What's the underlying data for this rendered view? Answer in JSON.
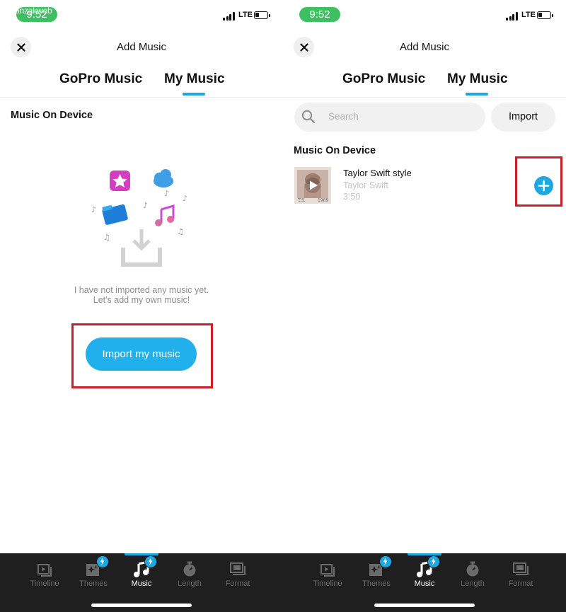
{
  "watermark": "anzakweb",
  "colors": {
    "accent": "#1fa8e0",
    "status_pill": "#3dbf62",
    "highlight_box": "#cc1f2a",
    "bottom_bar": "#1f1f1f"
  },
  "left_screen": {
    "status": {
      "time": "9:52",
      "network": "LTE"
    },
    "header": {
      "title": "Add Music",
      "close_icon": "close-icon"
    },
    "tabs": [
      {
        "label": "GoPro Music",
        "active": false
      },
      {
        "label": "My Music",
        "active": true
      }
    ],
    "section_title": "Music On Device",
    "empty_state": {
      "illustration_icons": [
        "star-app-icon",
        "cloud-icon",
        "folder-icon",
        "music-note-icon",
        "download-tray-icon"
      ],
      "line1": "I have not imported any music yet.",
      "line2": "Let's add my own music!",
      "button_label": "Import my music"
    },
    "bottom_nav": [
      {
        "label": "Timeline",
        "icon": "timeline-icon",
        "badge": false,
        "active": false
      },
      {
        "label": "Themes",
        "icon": "themes-icon",
        "badge": true,
        "active": false
      },
      {
        "label": "Music",
        "icon": "music-icon",
        "badge": true,
        "active": true
      },
      {
        "label": "Length",
        "icon": "stopwatch-icon",
        "badge": false,
        "active": false
      },
      {
        "label": "Format",
        "icon": "format-icon",
        "badge": false,
        "active": false
      }
    ]
  },
  "right_screen": {
    "status": {
      "time": "9:52",
      "network": "LTE"
    },
    "header": {
      "title": "Add Music",
      "close_icon": "close-icon"
    },
    "tabs": [
      {
        "label": "GoPro Music",
        "active": false
      },
      {
        "label": "My Music",
        "active": true
      }
    ],
    "search": {
      "placeholder": "Search",
      "icon": "search-icon"
    },
    "import_label": "Import",
    "section_title": "Music On Device",
    "tracks": [
      {
        "title": "Taylor Swift style",
        "artist": "Taylor Swift",
        "duration": "3:50",
        "thumb_caption_left": "T.S.",
        "thumb_caption_right": "1989",
        "add_icon": "plus-icon"
      }
    ],
    "bottom_nav": [
      {
        "label": "Timeline",
        "icon": "timeline-icon",
        "badge": false,
        "active": false
      },
      {
        "label": "Themes",
        "icon": "themes-icon",
        "badge": true,
        "active": false
      },
      {
        "label": "Music",
        "icon": "music-icon",
        "badge": true,
        "active": true
      },
      {
        "label": "Length",
        "icon": "stopwatch-icon",
        "badge": false,
        "active": false
      },
      {
        "label": "Format",
        "icon": "format-icon",
        "badge": false,
        "active": false
      }
    ]
  }
}
